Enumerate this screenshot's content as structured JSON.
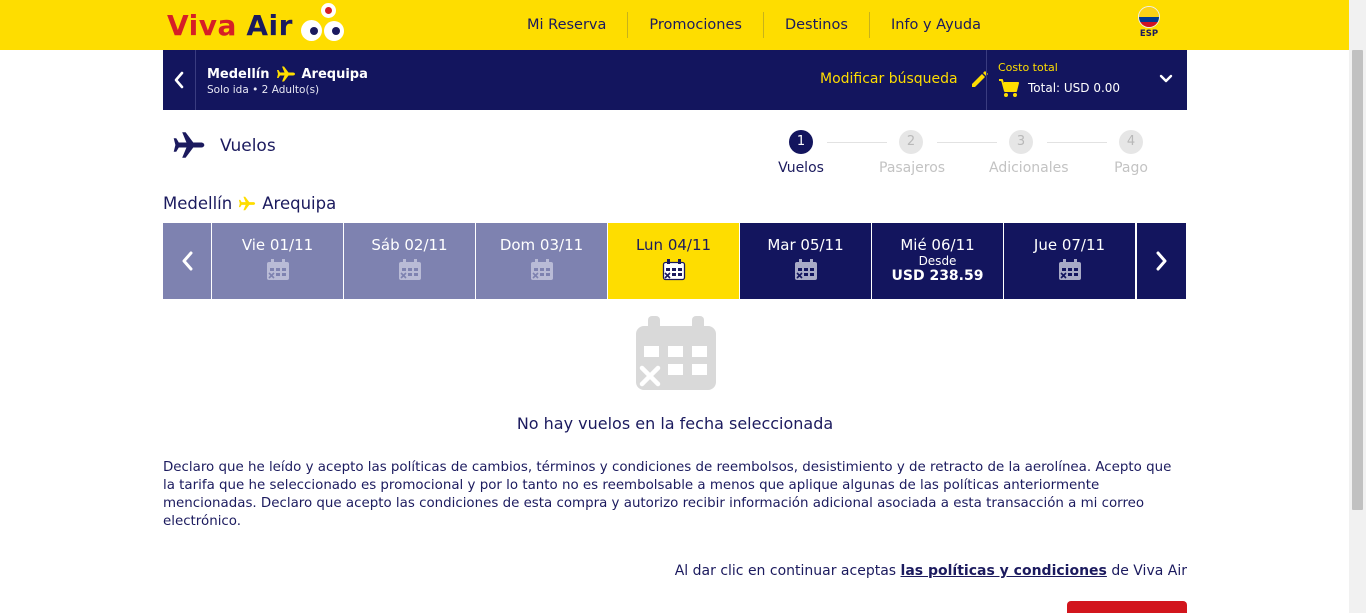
{
  "header": {
    "logo_viva": "Viva",
    "logo_air": "Air",
    "nav": [
      "Mi Reserva",
      "Promociones",
      "Destinos",
      "Info y Ayuda"
    ],
    "language": "ESP"
  },
  "summary": {
    "origin": "Medellín",
    "destination": "Arequipa",
    "trip_info": "Solo ida",
    "passengers": "2 Adulto(s)",
    "modify_label": "Modificar búsqueda",
    "cost_label": "Costo total",
    "total_label": "Total: USD 0.00"
  },
  "section": {
    "title": "Vuelos"
  },
  "steps": [
    {
      "number": "1",
      "label": "Vuelos"
    },
    {
      "number": "2",
      "label": "Pasajeros"
    },
    {
      "number": "3",
      "label": "Adicionales"
    },
    {
      "number": "4",
      "label": "Pago"
    }
  ],
  "route_heading": {
    "origin": "Medellín",
    "destination": "Arequipa"
  },
  "dates": [
    {
      "label": "Vie 01/11",
      "from": "",
      "price": ""
    },
    {
      "label": "Sáb 02/11",
      "from": "",
      "price": ""
    },
    {
      "label": "Dom 03/11",
      "from": "",
      "price": ""
    },
    {
      "label": "Lun 04/11",
      "from": "",
      "price": ""
    },
    {
      "label": "Mar 05/11",
      "from": "",
      "price": ""
    },
    {
      "label": "Mié 06/11",
      "from": "Desde",
      "price": "USD 238.59"
    },
    {
      "label": "Jue 07/11",
      "from": "",
      "price": ""
    }
  ],
  "empty_state": {
    "message": "No hay vuelos en la fecha seleccionada"
  },
  "declaration": "Declaro que he leído y acepto las políticas de cambios, términos y condiciones de reembolsos, desistimiento y de retracto de la aerolínea. Acepto que la tarifa que he seleccionado es promocional y por lo tanto no es reembolsable a menos que aplique algunas de las políticas anteriormente mencionadas. Declaro que acepto las condiciones de esta compra y autorizo recibir información adicional asociada a esta transacción a mi correo electrónico.",
  "terms": {
    "prefix": "Al dar clic en continuar aceptas ",
    "link": "las políticas y condiciones",
    "suffix": " de Viva Air"
  },
  "colors": {
    "brand_yellow": "#fedd00",
    "brand_navy": "#13155e",
    "brand_red": "#d61f26",
    "past_date": "#7e82b0",
    "selected_date": "#fedd00"
  }
}
